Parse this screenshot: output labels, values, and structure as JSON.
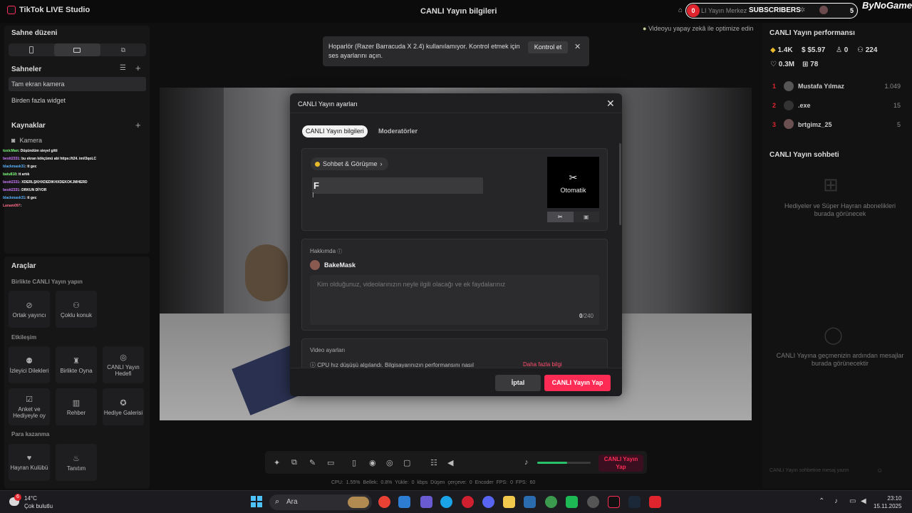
{
  "titlebar": {
    "app_name": "TikTok LIVE Studio",
    "center_title": "CANLI Yayın bilgileri"
  },
  "subscribers_widget": {
    "badge": "0",
    "live_center": "LI Yayın Merkez",
    "label": "SUBSCRIBERS",
    "count": "5",
    "brand": "ByNoGame"
  },
  "left": {
    "scene_layout_title": "Sahne düzeni",
    "scenes_title": "Sahneler",
    "scenes": [
      "Tam ekran kamera",
      "Birden fazla widget"
    ],
    "sources_title": "Kaynaklar",
    "sources": [
      {
        "label": "Kamera"
      }
    ],
    "chat": [
      {
        "user": "toxicMan",
        "text": ": Düşündüm sieyel gitti",
        "color": "#7dff7d"
      },
      {
        "user": "bestt2331",
        "text": ": bu ekran kökçümü abi https://t24. im/l3qoLC",
        "color": "#d07bff"
      },
      {
        "user": "blackmask31",
        "text": ": tt gec",
        "color": "#5ab4ff"
      },
      {
        "user": "batu818",
        "text": ": tt artık",
        "color": "#7dff7d"
      },
      {
        "user": "bestt2331",
        "text": ": XDERLŞKHXDEDIKHXDEKOKJMHERD",
        "color": "#d07bff"
      },
      {
        "user": "bestt2331",
        "text": ": DRKUN DİYOR",
        "color": "#d07bff"
      },
      {
        "user": "blackmask31",
        "text": ": tt gec",
        "color": "#5ab4ff"
      },
      {
        "user": "Lanam097",
        "text": ":",
        "color": "#ff6b8a"
      }
    ],
    "tools_title": "Araçlar",
    "collab_title": "Birlikte CANLI Yayın yapın",
    "collab": [
      "Ortak yayıncı",
      "Çoklu konuk"
    ],
    "interaction_title": "Etkileşim",
    "interaction": [
      "İzleyici Dilekleri",
      "Birlikte Oyna",
      "CANLI Yayın Hedefi",
      "Anket ve Hediyeyle oy",
      "Rehber",
      "Hediye Galerisi"
    ],
    "earn_title": "Para kazanma",
    "earn": [
      "Hayran Kulübü",
      "Tanıtım"
    ]
  },
  "toast": {
    "message": "Hoparlör (Razer Barracuda X 2.4) kullanılamıyor. Kontrol etmek için ses ayarlarını açın.",
    "action": "Kontrol et"
  },
  "optimize_hint": "Videoyu yapay zekâ ile optimize edin",
  "dialog": {
    "title": "CANLI Yayın ayarları",
    "tabs": [
      "CANLI Yayın bilgileri",
      "Moderatörler"
    ],
    "category": "Sohbet & Görüşme",
    "title_value": "F",
    "thumbnail_label": "Otomatik",
    "about_label": "Hakkımda",
    "username": "BakeMask",
    "bio_placeholder": "Kim olduğunuz, videolarınızın neyle ilgili olacağı ve ek faydalarınız",
    "bio_count": "0",
    "bio_max": "/240",
    "video_settings_label": "Video ayarları",
    "video_warning": "CPU hız düşüşü algılandı. Bilgisayarınızın performansını nasıl",
    "video_link": "Daha fazla bilgi",
    "cancel": "İptal",
    "go_live": "CANLI Yayın Yap"
  },
  "bottom_toolbar": {
    "go_live": "CANLI Yayın Yap",
    "volume_fraction": 0.56
  },
  "stats": "CPU: 1.55%   Bellek: 0.8%   Yükle: 0 kbps   Düşen çerçeve: 0   Encoder FPS: 0   FPS: 60",
  "right": {
    "performance_title": "CANLI Yayın performansı",
    "metrics": {
      "diamonds": "1.4K",
      "money": "$5.97",
      "viewers": "0",
      "followers": "224",
      "likes": "0.3M",
      "gifts": "78"
    },
    "leaderboard": [
      {
        "rank": "1",
        "name": "Mustafa Yılmaz",
        "value": "1.049"
      },
      {
        "rank": "2",
        "name": ".exe",
        "value": "15"
      },
      {
        "rank": "3",
        "name": "brtgimz_25",
        "value": "5"
      }
    ],
    "chat_title": "CANLI Yayın sohbeti",
    "gifts_empty": "Hediyeler ve Süper Hayran abonelikleri burada görünecek",
    "chat_empty": "CANLI Yayına geçmenizin ardından mesajlar burada görünecektir",
    "chat_placeholder": "CANLI Yayın sohbetine mesaj yazın"
  },
  "taskbar": {
    "temp": "14°C",
    "weather": "Çok bulutlu",
    "weather_badge": "6",
    "search_placeholder": "Ara",
    "time": "23:10",
    "date": "15.11.2025"
  }
}
